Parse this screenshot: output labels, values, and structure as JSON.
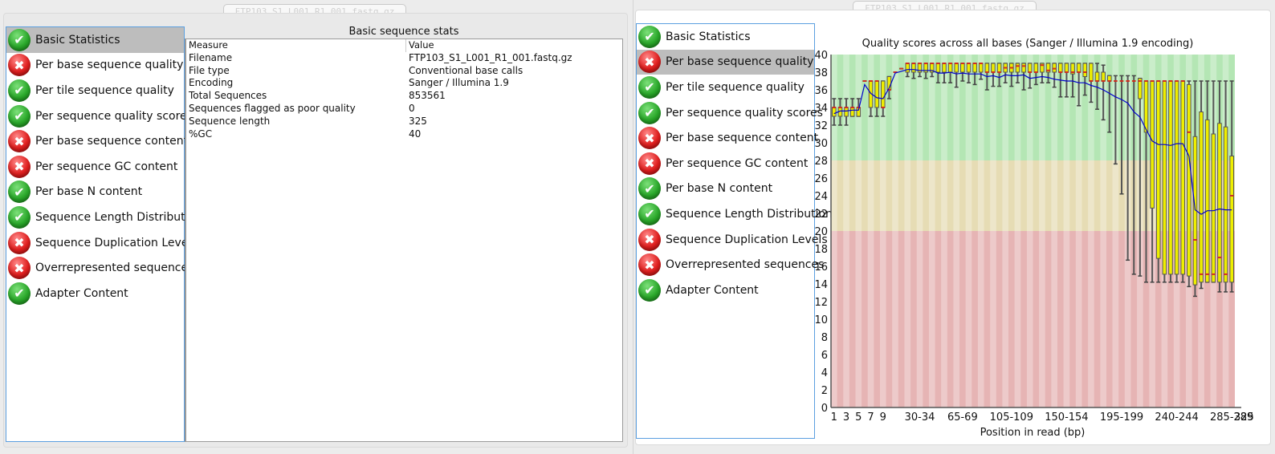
{
  "left_window": {
    "tab_label": "FTP103_S1_L001_R1_001.fastq.gz",
    "selected_index": 0
  },
  "right_window": {
    "tab_label": "FTP103_S1_L001_R1_001.fastq.gz",
    "selected_index": 1
  },
  "modules": [
    {
      "label": "Basic Statistics",
      "status": "pass",
      "icon": "check-circle-icon"
    },
    {
      "label": "Per base sequence quality",
      "status": "fail",
      "icon": "cross-circle-icon"
    },
    {
      "label": "Per tile sequence quality",
      "status": "pass",
      "icon": "check-circle-icon"
    },
    {
      "label": "Per sequence quality scores",
      "status": "pass",
      "icon": "check-circle-icon"
    },
    {
      "label": "Per base sequence content",
      "status": "fail",
      "icon": "cross-circle-icon"
    },
    {
      "label": "Per sequence GC content",
      "status": "fail",
      "icon": "cross-circle-icon"
    },
    {
      "label": "Per base N content",
      "status": "pass",
      "icon": "check-circle-icon"
    },
    {
      "label": "Sequence Length Distribution",
      "status": "pass",
      "icon": "check-circle-icon"
    },
    {
      "label": "Sequence Duplication Levels",
      "status": "fail",
      "icon": "cross-circle-icon"
    },
    {
      "label": "Overrepresented sequences",
      "status": "fail",
      "icon": "cross-circle-icon"
    },
    {
      "label": "Adapter Content",
      "status": "pass",
      "icon": "check-circle-icon"
    }
  ],
  "basic_stats": {
    "title": "Basic sequence stats",
    "columns": [
      "Measure",
      "Value"
    ],
    "rows": [
      [
        "Filename",
        "FTP103_S1_L001_R1_001.fastq.gz"
      ],
      [
        "File type",
        "Conventional base calls"
      ],
      [
        "Encoding",
        "Sanger / Illumina 1.9"
      ],
      [
        "Total Sequences",
        "853561"
      ],
      [
        "Sequences flagged as poor quality",
        "0"
      ],
      [
        "Sequence length",
        "325"
      ],
      [
        "%GC",
        "40"
      ]
    ]
  },
  "colors": {
    "pass": "#2aa82a",
    "fail": "#e01f1f",
    "selection": "#bdbdbd",
    "list_border": "#5b9fe0",
    "zone_good": "#b4e6b4",
    "zone_warn": "#e6dcb4",
    "zone_bad": "#e6b4b4",
    "box_fill": "#eeee00",
    "mean_line": "#0000cc",
    "median_mark": "#d03020"
  },
  "chart_data": {
    "type": "boxplot",
    "title": "Quality scores across all bases (Sanger / Illumina 1.9 encoding)",
    "xlabel": "Position in read (bp)",
    "ylabel": "",
    "ylim": [
      0,
      40
    ],
    "yticks": [
      0,
      2,
      4,
      6,
      8,
      10,
      12,
      14,
      16,
      18,
      20,
      22,
      24,
      26,
      28,
      30,
      32,
      34,
      36,
      38,
      40
    ],
    "xtick_labels": [
      "1",
      "3",
      "5",
      "7",
      "9",
      "30-34",
      "65-69",
      "105-109",
      "150-154",
      "195-199",
      "240-244",
      "285-289",
      "325"
    ],
    "zones": [
      {
        "name": "good",
        "from": 28,
        "to": 40
      },
      {
        "name": "warning",
        "from": 20,
        "to": 28
      },
      {
        "name": "poor",
        "from": 0,
        "to": 20
      }
    ],
    "series": [
      {
        "name": "boxes",
        "columns": [
          {
            "lo": 32,
            "q1": 33,
            "med": 34,
            "q3": 34,
            "hi": 35,
            "mean": 33.3
          },
          {
            "lo": 32,
            "q1": 33,
            "med": 34,
            "q3": 34,
            "hi": 35,
            "mean": 33.6
          },
          {
            "lo": 32,
            "q1": 33,
            "med": 34,
            "q3": 34,
            "hi": 35,
            "mean": 33.6
          },
          {
            "lo": 33,
            "q1": 33,
            "med": 34,
            "q3": 34,
            "hi": 35,
            "mean": 33.7
          },
          {
            "lo": 33,
            "q1": 33,
            "med": 34,
            "q3": 34,
            "hi": 35,
            "mean": 33.7
          },
          {
            "lo": 37,
            "q1": 37,
            "med": 37,
            "q3": 37,
            "hi": 37,
            "mean": 36.6
          },
          {
            "lo": 33,
            "q1": 34,
            "med": 37,
            "q3": 37,
            "hi": 37,
            "mean": 35.6
          },
          {
            "lo": 33,
            "q1": 34,
            "med": 37,
            "q3": 37,
            "hi": 37,
            "mean": 35.1
          },
          {
            "lo": 33,
            "q1": 34,
            "med": 34,
            "q3": 37,
            "hi": 37,
            "mean": 35.0
          },
          {
            "lo": 35,
            "q1": 36,
            "med": 36,
            "q3": 37.5,
            "hi": 37.5,
            "mean": 36.2
          },
          {
            "lo": 38,
            "q1": 38,
            "med": 38,
            "q3": 38,
            "hi": 38,
            "mean": 37.9
          },
          {
            "lo": 38.4,
            "q1": 38.4,
            "med": 38.4,
            "q3": 38.4,
            "hi": 38.4,
            "mean": 38.1
          },
          {
            "lo": 37.5,
            "q1": 38,
            "med": 39,
            "q3": 39,
            "hi": 39,
            "mean": 38.3
          },
          {
            "lo": 37.3,
            "q1": 38,
            "med": 39,
            "q3": 39,
            "hi": 39,
            "mean": 38.3
          },
          {
            "lo": 37.5,
            "q1": 38,
            "med": 39,
            "q3": 39,
            "hi": 39,
            "mean": 38.2
          },
          {
            "lo": 37.3,
            "q1": 38,
            "med": 39,
            "q3": 39,
            "hi": 39,
            "mean": 38.2
          },
          {
            "lo": 37.5,
            "q1": 38,
            "med": 39,
            "q3": 39,
            "hi": 39,
            "mean": 38.2
          },
          {
            "lo": 36.8,
            "q1": 38,
            "med": 39,
            "q3": 39,
            "hi": 39,
            "mean": 37.9
          },
          {
            "lo": 36.8,
            "q1": 38,
            "med": 39,
            "q3": 39,
            "hi": 39,
            "mean": 37.9
          },
          {
            "lo": 36.8,
            "q1": 38,
            "med": 39,
            "q3": 39,
            "hi": 39,
            "mean": 38.0
          },
          {
            "lo": 36.3,
            "q1": 38,
            "med": 39,
            "q3": 39,
            "hi": 39,
            "mean": 37.8
          },
          {
            "lo": 37.0,
            "q1": 38,
            "med": 39,
            "q3": 39,
            "hi": 39,
            "mean": 37.9
          },
          {
            "lo": 36.8,
            "q1": 38,
            "med": 39,
            "q3": 39,
            "hi": 39,
            "mean": 37.8
          },
          {
            "lo": 36.6,
            "q1": 38,
            "med": 39,
            "q3": 39,
            "hi": 39,
            "mean": 37.8
          },
          {
            "lo": 37.2,
            "q1": 38,
            "med": 39,
            "q3": 39,
            "hi": 39,
            "mean": 37.8
          },
          {
            "lo": 36.0,
            "q1": 38,
            "med": 38,
            "q3": 39,
            "hi": 39,
            "mean": 37.5
          },
          {
            "lo": 36.4,
            "q1": 38,
            "med": 38,
            "q3": 39,
            "hi": 39,
            "mean": 37.6
          },
          {
            "lo": 36.4,
            "q1": 38,
            "med": 38,
            "q3": 39,
            "hi": 39,
            "mean": 37.4
          },
          {
            "lo": 36.8,
            "q1": 38,
            "med": 38.5,
            "q3": 39,
            "hi": 39,
            "mean": 37.7
          },
          {
            "lo": 36.4,
            "q1": 38,
            "med": 38.5,
            "q3": 39,
            "hi": 39,
            "mean": 37.6
          },
          {
            "lo": 36.8,
            "q1": 38,
            "med": 38.7,
            "q3": 39,
            "hi": 39,
            "mean": 37.6
          },
          {
            "lo": 36.0,
            "q1": 38,
            "med": 38.7,
            "q3": 39,
            "hi": 39,
            "mean": 37.7
          },
          {
            "lo": 36.2,
            "q1": 38,
            "med": 38,
            "q3": 39,
            "hi": 39,
            "mean": 37.3
          },
          {
            "lo": 36.6,
            "q1": 38,
            "med": 38,
            "q3": 39,
            "hi": 39,
            "mean": 37.4
          },
          {
            "lo": 36.8,
            "q1": 38,
            "med": 38.8,
            "q3": 39,
            "hi": 39,
            "mean": 37.5
          },
          {
            "lo": 36.8,
            "q1": 38,
            "med": 38.2,
            "q3": 39,
            "hi": 39,
            "mean": 37.4
          },
          {
            "lo": 36.3,
            "q1": 38,
            "med": 38.4,
            "q3": 39,
            "hi": 39,
            "mean": 37.2
          },
          {
            "lo": 35.2,
            "q1": 38,
            "med": 38,
            "q3": 39,
            "hi": 39,
            "mean": 37.1
          },
          {
            "lo": 35.2,
            "q1": 38,
            "med": 38,
            "q3": 39,
            "hi": 39,
            "mean": 37.0
          },
          {
            "lo": 35.2,
            "q1": 37.8,
            "med": 38,
            "q3": 39,
            "hi": 39,
            "mean": 37.0
          },
          {
            "lo": 34.2,
            "q1": 38,
            "med": 38,
            "q3": 39,
            "hi": 39,
            "mean": 36.8
          },
          {
            "lo": 35.4,
            "q1": 37.5,
            "med": 38,
            "q3": 39,
            "hi": 39,
            "mean": 36.8
          },
          {
            "lo": 34.6,
            "q1": 37,
            "med": 37,
            "q3": 39,
            "hi": 39,
            "mean": 36.5
          },
          {
            "lo": 33.8,
            "q1": 37,
            "med": 37,
            "q3": 38,
            "hi": 39,
            "mean": 36.3
          },
          {
            "lo": 32.6,
            "q1": 37,
            "med": 37,
            "q3": 38,
            "hi": 38.8,
            "mean": 36.0
          },
          {
            "lo": 31.2,
            "q1": 37,
            "med": 37,
            "q3": 37.6,
            "hi": 37.6,
            "mean": 35.6
          },
          {
            "lo": 27.6,
            "q1": 37,
            "med": 37,
            "q3": 37,
            "hi": 37.6,
            "mean": 35.2
          },
          {
            "lo": 24.2,
            "q1": 37,
            "med": 37,
            "q3": 37,
            "hi": 37.6,
            "mean": 34.9
          },
          {
            "lo": 16.7,
            "q1": 37,
            "med": 37,
            "q3": 37,
            "hi": 37.6,
            "mean": 34.5
          },
          {
            "lo": 15.1,
            "q1": 37,
            "med": 37,
            "q3": 37,
            "hi": 37.6,
            "mean": 33.5
          },
          {
            "lo": 14.9,
            "q1": 35,
            "med": 37,
            "q3": 37.3,
            "hi": 37.3,
            "mean": 32.9
          },
          {
            "lo": 14.2,
            "q1": 31.2,
            "med": 37,
            "q3": 37,
            "hi": 37,
            "mean": 31.5
          },
          {
            "lo": 14.2,
            "q1": 22.6,
            "med": 37,
            "q3": 37,
            "hi": 37,
            "mean": 30.2
          },
          {
            "lo": 14.2,
            "q1": 16.9,
            "med": 37,
            "q3": 37,
            "hi": 37,
            "mean": 29.8
          },
          {
            "lo": 14.2,
            "q1": 15.1,
            "med": 37,
            "q3": 37,
            "hi": 37,
            "mean": 29.8
          },
          {
            "lo": 14.2,
            "q1": 15.1,
            "med": 37,
            "q3": 37,
            "hi": 37,
            "mean": 29.7
          },
          {
            "lo": 14.2,
            "q1": 15.1,
            "med": 37,
            "q3": 37,
            "hi": 37,
            "mean": 29.9
          },
          {
            "lo": 14.2,
            "q1": 15.1,
            "med": 37,
            "q3": 37,
            "hi": 37,
            "mean": 29.9
          },
          {
            "lo": 13.7,
            "q1": 14.9,
            "med": 31.2,
            "q3": 36.6,
            "hi": 37,
            "mean": 28.5
          },
          {
            "lo": 12.6,
            "q1": 13.9,
            "med": 19.0,
            "q3": 30.7,
            "hi": 37,
            "mean": 22.4
          },
          {
            "lo": 13.5,
            "q1": 14.2,
            "med": 15.1,
            "q3": 33.5,
            "hi": 37,
            "mean": 21.9
          },
          {
            "lo": 14.2,
            "q1": 14.2,
            "med": 15.1,
            "q3": 32.6,
            "hi": 37,
            "mean": 22.3
          },
          {
            "lo": 14.2,
            "q1": 14.2,
            "med": 15.1,
            "q3": 31.0,
            "hi": 37,
            "mean": 22.3
          },
          {
            "lo": 13.1,
            "q1": 14.2,
            "med": 17.0,
            "q3": 32.2,
            "hi": 37,
            "mean": 22.5
          },
          {
            "lo": 13.1,
            "q1": 14.2,
            "med": 15.1,
            "q3": 31.8,
            "hi": 37,
            "mean": 22.4
          },
          {
            "lo": 13.1,
            "q1": 14.2,
            "med": 24.0,
            "q3": 28.5,
            "hi": 37,
            "mean": 22.4
          }
        ]
      }
    ],
    "grid": false,
    "legend": "none"
  }
}
